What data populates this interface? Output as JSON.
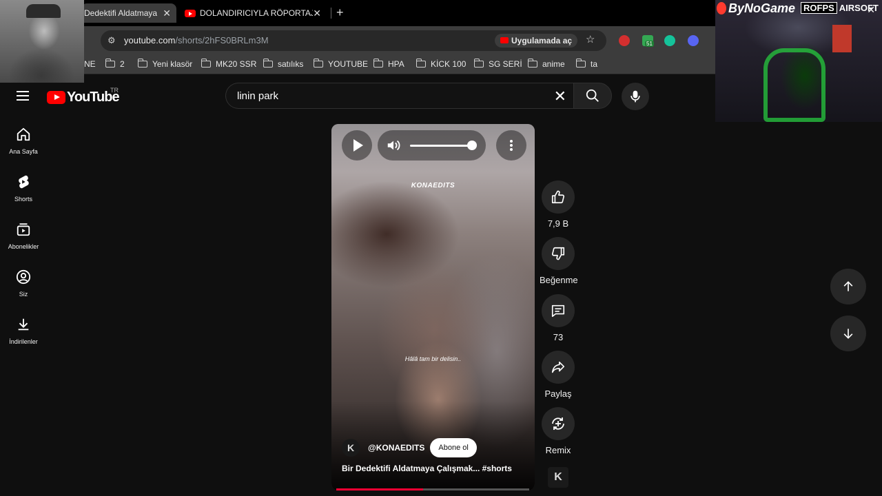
{
  "browser": {
    "tabs": [
      {
        "title": "Dedektifi Aldatmaya",
        "active": true
      },
      {
        "title": "DOLANDIRICIYLA RÖPORTAJ YA",
        "active": false
      }
    ],
    "url_host": "youtube.com",
    "url_path": "/shorts/2hFS0BRLm3M",
    "open_in_app": "Uygulamada aç",
    "extension_badge": "51",
    "bookmarks": [
      "NE",
      "2",
      "Yeni klasör",
      "MK20 SSR",
      "satılıks",
      "YOUTUBE",
      "HPA",
      "KİCK 100",
      "SG SERİ",
      "anime",
      "ta"
    ]
  },
  "youtube": {
    "logo": "YouTube",
    "region": "TR",
    "search_query": "linin park",
    "sidebar": [
      {
        "label": "Ana Sayfa",
        "icon": "home-icon"
      },
      {
        "label": "Shorts",
        "icon": "shorts-icon"
      },
      {
        "label": "Abonelikler",
        "icon": "subscriptions-icon"
      },
      {
        "label": "Siz",
        "icon": "you-icon"
      },
      {
        "label": "İndirilenler",
        "icon": "downloads-icon"
      }
    ]
  },
  "short": {
    "watermark": "KONAEDITS",
    "subtitle": "Hâlâ tam bir delisin..",
    "channel": "@KONAEDITS",
    "channel_avatar": "K",
    "subscribe": "Abone ol",
    "title": "Bir Dedektifi Aldatmaya Çalışmak... #shorts",
    "progress_percent": 45,
    "volume_percent": 100
  },
  "actions": {
    "likes": "7,9 B",
    "dislike": "Beğenme",
    "comments": "73",
    "share": "Paylaş",
    "remix": "Remix"
  },
  "overlay": {
    "brand_1": "ByNoGame",
    "brand_2_box": "ROFPS",
    "brand_2_text": "AIRSOFT"
  },
  "colors": {
    "accent": "#ff0000",
    "progress": "#ff0033",
    "background": "#0f0f0f"
  }
}
